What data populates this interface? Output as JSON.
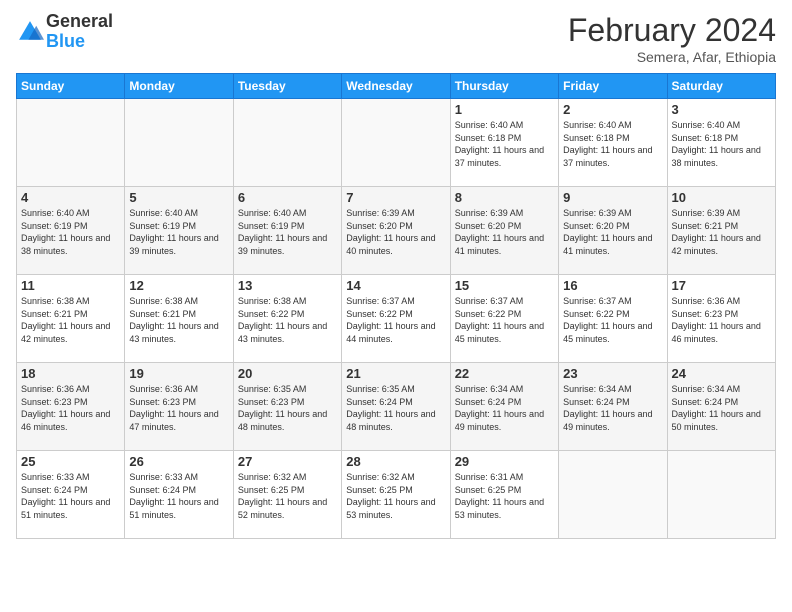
{
  "header": {
    "logo_general": "General",
    "logo_blue": "Blue",
    "title": "February 2024",
    "subtitle": "Semera, Afar, Ethiopia"
  },
  "days_of_week": [
    "Sunday",
    "Monday",
    "Tuesday",
    "Wednesday",
    "Thursday",
    "Friday",
    "Saturday"
  ],
  "weeks": [
    [
      {
        "num": "",
        "info": ""
      },
      {
        "num": "",
        "info": ""
      },
      {
        "num": "",
        "info": ""
      },
      {
        "num": "",
        "info": ""
      },
      {
        "num": "1",
        "info": "Sunrise: 6:40 AM\nSunset: 6:18 PM\nDaylight: 11 hours and 37 minutes."
      },
      {
        "num": "2",
        "info": "Sunrise: 6:40 AM\nSunset: 6:18 PM\nDaylight: 11 hours and 37 minutes."
      },
      {
        "num": "3",
        "info": "Sunrise: 6:40 AM\nSunset: 6:18 PM\nDaylight: 11 hours and 38 minutes."
      }
    ],
    [
      {
        "num": "4",
        "info": "Sunrise: 6:40 AM\nSunset: 6:19 PM\nDaylight: 11 hours and 38 minutes."
      },
      {
        "num": "5",
        "info": "Sunrise: 6:40 AM\nSunset: 6:19 PM\nDaylight: 11 hours and 39 minutes."
      },
      {
        "num": "6",
        "info": "Sunrise: 6:40 AM\nSunset: 6:19 PM\nDaylight: 11 hours and 39 minutes."
      },
      {
        "num": "7",
        "info": "Sunrise: 6:39 AM\nSunset: 6:20 PM\nDaylight: 11 hours and 40 minutes."
      },
      {
        "num": "8",
        "info": "Sunrise: 6:39 AM\nSunset: 6:20 PM\nDaylight: 11 hours and 41 minutes."
      },
      {
        "num": "9",
        "info": "Sunrise: 6:39 AM\nSunset: 6:20 PM\nDaylight: 11 hours and 41 minutes."
      },
      {
        "num": "10",
        "info": "Sunrise: 6:39 AM\nSunset: 6:21 PM\nDaylight: 11 hours and 42 minutes."
      }
    ],
    [
      {
        "num": "11",
        "info": "Sunrise: 6:38 AM\nSunset: 6:21 PM\nDaylight: 11 hours and 42 minutes."
      },
      {
        "num": "12",
        "info": "Sunrise: 6:38 AM\nSunset: 6:21 PM\nDaylight: 11 hours and 43 minutes."
      },
      {
        "num": "13",
        "info": "Sunrise: 6:38 AM\nSunset: 6:22 PM\nDaylight: 11 hours and 43 minutes."
      },
      {
        "num": "14",
        "info": "Sunrise: 6:37 AM\nSunset: 6:22 PM\nDaylight: 11 hours and 44 minutes."
      },
      {
        "num": "15",
        "info": "Sunrise: 6:37 AM\nSunset: 6:22 PM\nDaylight: 11 hours and 45 minutes."
      },
      {
        "num": "16",
        "info": "Sunrise: 6:37 AM\nSunset: 6:22 PM\nDaylight: 11 hours and 45 minutes."
      },
      {
        "num": "17",
        "info": "Sunrise: 6:36 AM\nSunset: 6:23 PM\nDaylight: 11 hours and 46 minutes."
      }
    ],
    [
      {
        "num": "18",
        "info": "Sunrise: 6:36 AM\nSunset: 6:23 PM\nDaylight: 11 hours and 46 minutes."
      },
      {
        "num": "19",
        "info": "Sunrise: 6:36 AM\nSunset: 6:23 PM\nDaylight: 11 hours and 47 minutes."
      },
      {
        "num": "20",
        "info": "Sunrise: 6:35 AM\nSunset: 6:23 PM\nDaylight: 11 hours and 48 minutes."
      },
      {
        "num": "21",
        "info": "Sunrise: 6:35 AM\nSunset: 6:24 PM\nDaylight: 11 hours and 48 minutes."
      },
      {
        "num": "22",
        "info": "Sunrise: 6:34 AM\nSunset: 6:24 PM\nDaylight: 11 hours and 49 minutes."
      },
      {
        "num": "23",
        "info": "Sunrise: 6:34 AM\nSunset: 6:24 PM\nDaylight: 11 hours and 49 minutes."
      },
      {
        "num": "24",
        "info": "Sunrise: 6:34 AM\nSunset: 6:24 PM\nDaylight: 11 hours and 50 minutes."
      }
    ],
    [
      {
        "num": "25",
        "info": "Sunrise: 6:33 AM\nSunset: 6:24 PM\nDaylight: 11 hours and 51 minutes."
      },
      {
        "num": "26",
        "info": "Sunrise: 6:33 AM\nSunset: 6:24 PM\nDaylight: 11 hours and 51 minutes."
      },
      {
        "num": "27",
        "info": "Sunrise: 6:32 AM\nSunset: 6:25 PM\nDaylight: 11 hours and 52 minutes."
      },
      {
        "num": "28",
        "info": "Sunrise: 6:32 AM\nSunset: 6:25 PM\nDaylight: 11 hours and 53 minutes."
      },
      {
        "num": "29",
        "info": "Sunrise: 6:31 AM\nSunset: 6:25 PM\nDaylight: 11 hours and 53 minutes."
      },
      {
        "num": "",
        "info": ""
      },
      {
        "num": "",
        "info": ""
      }
    ]
  ]
}
